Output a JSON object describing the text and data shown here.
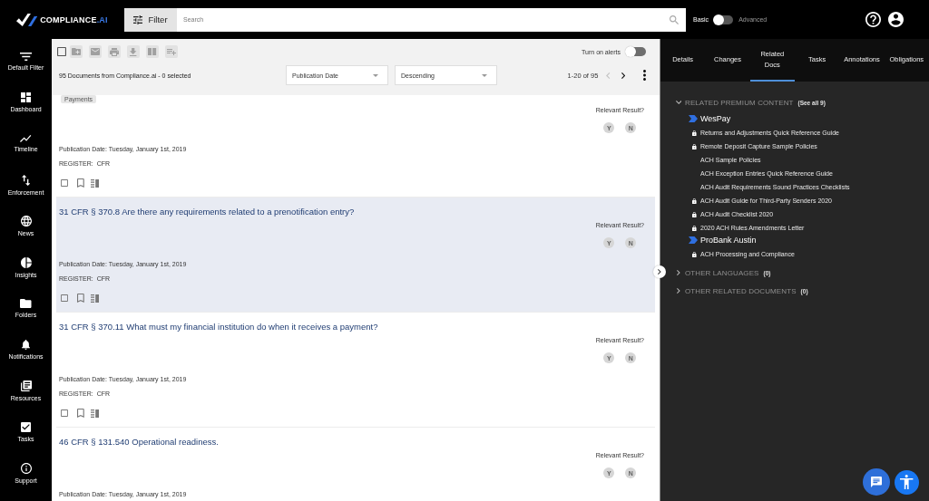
{
  "top_bar": {
    "logo": {
      "text": "COMPLIANCE",
      "accent": ".AI"
    },
    "filter_button": "Filter",
    "search": {
      "placeholder": "Search"
    },
    "mode_switch": {
      "left_label": "Basic",
      "right_label": "Advanced",
      "on": false
    }
  },
  "sidebar": {
    "items": [
      {
        "label": "Default Filter"
      },
      {
        "label": "Dashboard"
      },
      {
        "label": "Timeline"
      },
      {
        "label": "Enforcement"
      },
      {
        "label": "News"
      },
      {
        "label": "Insights"
      },
      {
        "label": "Folders"
      },
      {
        "label": "Notifications"
      },
      {
        "label": "Resources"
      },
      {
        "label": "Tasks"
      },
      {
        "label": "Support"
      }
    ]
  },
  "list_toolbar": {
    "select_all": {
      "checked": false
    },
    "bulk_actions": {
      "disabled": true
    },
    "alerts": {
      "label": "Turn on alerts",
      "on": false
    },
    "summary": "95 Documents from Compliance.ai - 0 selected",
    "sort_by": {
      "value": "Publication Date"
    },
    "sort_order": {
      "value": "Descending"
    },
    "pagination": {
      "range": "1-20 of 95",
      "prev_disabled": true,
      "next_disabled": false
    }
  },
  "documents": [
    {
      "tag": "Payments",
      "relevance_label": "Relevant Result?",
      "votes": [
        "Y",
        "N"
      ],
      "publication_date": "Publication Date: Tuesday, January 1st, 2019",
      "register_label": "REGISTER:",
      "register": "CFR",
      "checked": false,
      "highlighted": false
    },
    {
      "title": "31 CFR § 370.8 Are there any requirements related to a prenotification entry?",
      "relevance_label": "Relevant Result?",
      "votes": [
        "Y",
        "N"
      ],
      "publication_date": "Publication Date: Tuesday, January 1st, 2019",
      "register_label": "REGISTER:",
      "register": "CFR",
      "checked": false,
      "highlighted": true
    },
    {
      "title": "31 CFR § 370.11 What must my financial institution do when it receives a payment?",
      "relevance_label": "Relevant Result?",
      "votes": [
        "Y",
        "N"
      ],
      "publication_date": "Publication Date: Tuesday, January 1st, 2019",
      "register_label": "REGISTER:",
      "register": "CFR",
      "checked": false,
      "highlighted": false
    },
    {
      "title": "46 CFR § 131.540 Operational readiness.",
      "relevance_label": "Relevant Result?",
      "votes": [
        "Y",
        "N"
      ],
      "publication_date": "Publication Date: Tuesday, January 1st, 2019",
      "highlighted": false
    }
  ],
  "detail_panel": {
    "tabs": [
      {
        "label": "Details",
        "selected": false
      },
      {
        "label": "Changes",
        "selected": false
      },
      {
        "label": "Related Docs",
        "selected": true
      },
      {
        "label": "Tasks",
        "selected": false
      },
      {
        "label": "Annotations",
        "selected": false
      },
      {
        "label": "Obligations",
        "selected": false
      }
    ],
    "sections": [
      {
        "title": "RELATED PREMIUM CONTENT",
        "count": "(See all 9)",
        "expanded": true,
        "providers": [
          {
            "name": "WesPay",
            "documents": [
              {
                "title": "Returns and Adjustments Quick Reference Guide",
                "locked": true
              },
              {
                "title": "Remote Deposit Capture Sample Policies",
                "locked": true
              },
              {
                "title": "ACH Sample Policies",
                "locked": false
              },
              {
                "title": "ACH Exception Entries Quick Reference Guide",
                "locked": false
              },
              {
                "title": "ACH Audit Requirements Sound Practices Checklists",
                "locked": false
              },
              {
                "title": "ACH Audit Guide for Third-Party Senders 2020",
                "locked": true
              },
              {
                "title": "ACH Audit Checklist 2020",
                "locked": true
              },
              {
                "title": "2020 ACH Rules Amendments Letter",
                "locked": true
              }
            ]
          },
          {
            "name": "ProBank Austin",
            "documents": [
              {
                "title": "ACH Processing and Compliance",
                "locked": true
              }
            ]
          }
        ]
      },
      {
        "title": "OTHER LANGUAGES",
        "count": "(0)",
        "expanded": false
      },
      {
        "title": "OTHER RELATED DOCUMENTS",
        "count": "(0)",
        "expanded": false
      }
    ]
  }
}
